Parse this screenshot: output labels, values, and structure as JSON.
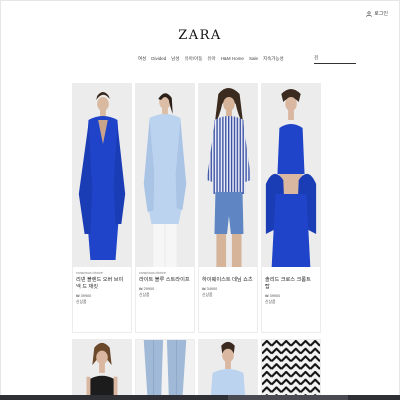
{
  "header": {
    "logo": "ZARA",
    "login_label": "로그인",
    "search_placeholder": "검"
  },
  "nav": {
    "items": [
      "여성",
      "Divided",
      "남성",
      "유아/아동",
      "유아",
      "H&M Home",
      "Sale",
      "지속가능성"
    ]
  },
  "products": [
    {
      "tag": "conscious choice",
      "name": "리넨 블렌드 오버 브이넥 드 재킷",
      "price": "₩ 39900",
      "badge": "신상품"
    },
    {
      "tag": "conscious choice",
      "name": "라이트 블루 스트라이프",
      "price": "₩ 29900",
      "badge": "신상품"
    },
    {
      "tag": "",
      "name": "하이웨이스트 데님 쇼츠",
      "price": "₩ 34900",
      "badge": "신상품"
    },
    {
      "tag": "",
      "name": "솔리드 크로스 크롭트 탑",
      "price": "₩ 39900",
      "badge": "신상품"
    }
  ],
  "colors": {
    "cobalt": "#1f44c9",
    "light_blue": "#bcd3ef",
    "stripe": "#3a4fa3",
    "background": "#ffffff"
  }
}
